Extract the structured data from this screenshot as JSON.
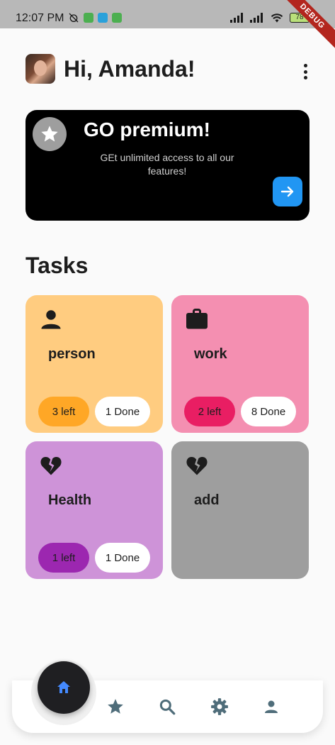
{
  "status_bar": {
    "time": "12:07 PM",
    "battery": "78",
    "debug_label": "DEBUG"
  },
  "header": {
    "greeting": "Hi, Amanda!",
    "avatar_icon": "user-photo",
    "menu_icon": "more-vert-icon"
  },
  "premium": {
    "title": "GO premium!",
    "subtitle": "GEt unlimited access to all our features!",
    "star_icon": "star-icon",
    "arrow_icon": "arrow-forward-icon",
    "accent": "#2196f3",
    "background": "#000000"
  },
  "tasks": {
    "title": "Tasks",
    "cards": [
      {
        "label": "person",
        "icon": "person-icon",
        "left": "3 left",
        "done": "1 Done",
        "color": "#ffcc80",
        "pill_color": "#ffa726"
      },
      {
        "label": "work",
        "icon": "briefcase-icon",
        "left": "2 left",
        "done": "8 Done",
        "color": "#f48fb1",
        "pill_color": "#e91e63"
      },
      {
        "label": "Health",
        "icon": "heart-broken-icon",
        "left": "1 left",
        "done": "1 Done",
        "color": "#ce93d8",
        "pill_color": "#9c27b0"
      },
      {
        "label": "add",
        "icon": "heart-broken-icon",
        "color": "#9e9e9e"
      }
    ]
  },
  "bottom_nav": {
    "active": "home",
    "items": [
      "home-icon",
      "star-icon",
      "search-icon",
      "settings-icon",
      "person-icon"
    ],
    "active_color": "#448aff",
    "icon_color": "#4f6d7a"
  }
}
